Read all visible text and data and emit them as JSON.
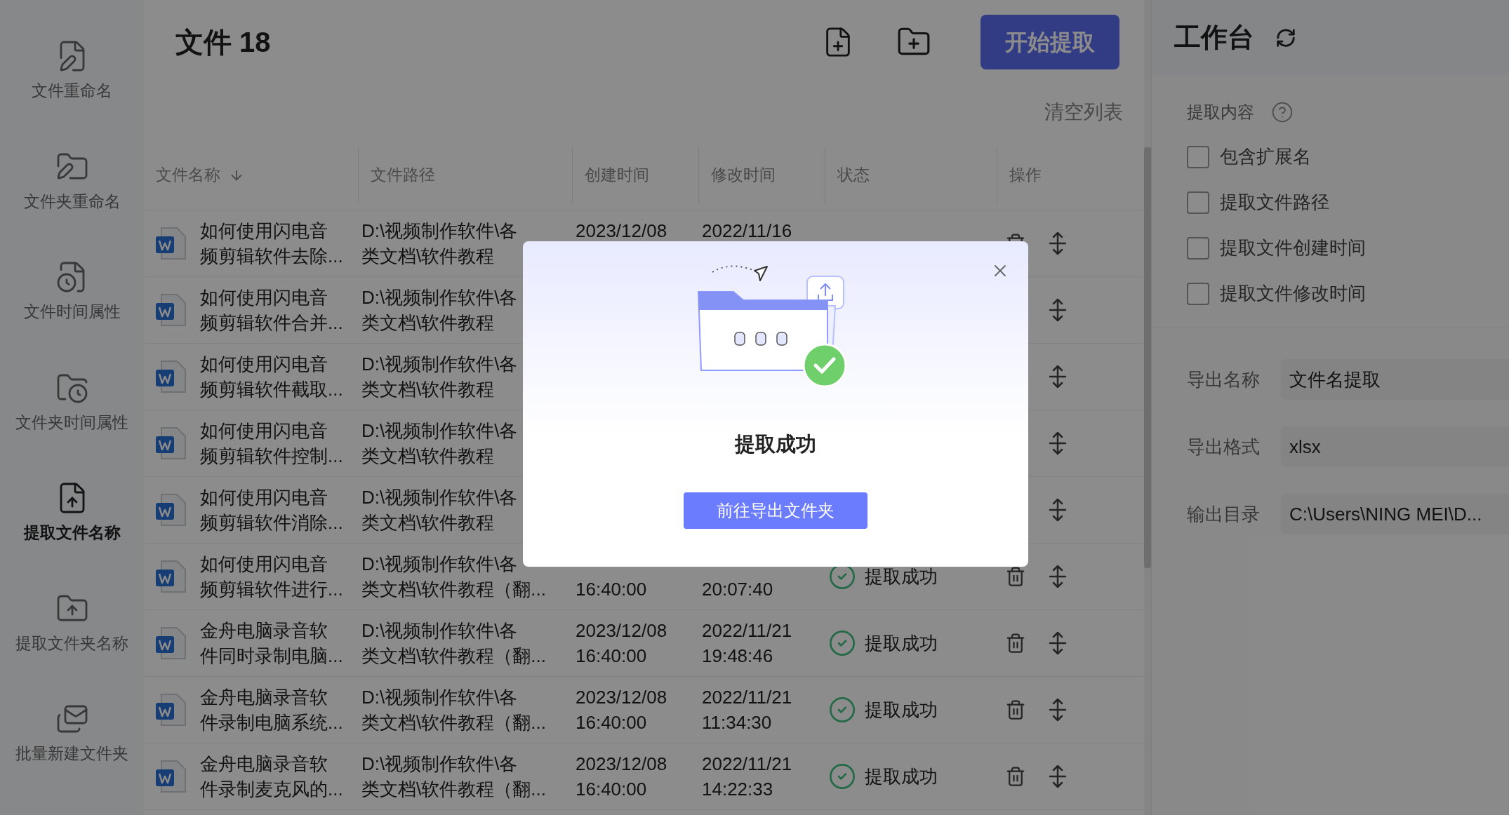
{
  "sidebar": {
    "items": [
      {
        "label": "文件重命名",
        "selected": false
      },
      {
        "label": "文件夹重命名",
        "selected": false
      },
      {
        "label": "文件时间属性",
        "selected": false
      },
      {
        "label": "文件夹时间属性",
        "selected": false
      },
      {
        "label": "提取文件名称",
        "selected": true
      },
      {
        "label": "提取文件夹名称",
        "selected": false
      },
      {
        "label": "批量新建文件夹",
        "selected": false
      }
    ]
  },
  "header": {
    "title": "文件 18",
    "start_button": "开始提取",
    "clear_link": "清空列表"
  },
  "table": {
    "columns": [
      "文件名称",
      "文件路径",
      "创建时间",
      "修改时间",
      "状态",
      "操作"
    ],
    "rows": [
      {
        "name": "如何使用闪电音频剪辑软件去除...",
        "path": "D:\\视频制作软件\\各类文档\\软件教程",
        "created_date": "2023/12/08",
        "modified_date": "2022/11/16"
      },
      {
        "name": "如何使用闪电音频剪辑软件合并...",
        "path": "D:\\视频制作软件\\各类文档\\软件教程",
        "delete_shown": false
      },
      {
        "name": "如何使用闪电音频剪辑软件截取...",
        "path": "D:\\视频制作软件\\各类文档\\软件教程",
        "delete_shown": false
      },
      {
        "name": "如何使用闪电音频剪辑软件控制...",
        "path": "D:\\视频制作软件\\各类文档\\软件教程",
        "delete_shown": false
      },
      {
        "name": "如何使用闪电音频剪辑软件消除...",
        "path": "D:\\视频制作软件\\各类文档\\软件教程",
        "delete_shown": false
      },
      {
        "name": "如何使用闪电音频剪辑软件进行...",
        "path": "D:\\视频制作软件\\各类文档\\软件教程（翻...",
        "created_time": "16:40:00",
        "modified_time": "20:07:40",
        "status": "提取成功"
      },
      {
        "name": "金舟电脑录音软件同时录制电脑...",
        "path": "D:\\视频制作软件\\各类文档\\软件教程（翻...",
        "created_date": "2023/12/08",
        "created_time": "16:40:00",
        "modified_date": "2022/11/21",
        "modified_time": "19:48:46",
        "status": "提取成功"
      },
      {
        "name": "金舟电脑录音软件录制电脑系统...",
        "path": "D:\\视频制作软件\\各类文档\\软件教程（翻...",
        "created_date": "2023/12/08",
        "created_time": "16:40:00",
        "modified_date": "2022/11/21",
        "modified_time": "11:34:30",
        "status": "提取成功"
      },
      {
        "name": "金舟电脑录音软件录制麦克风的...",
        "path": "D:\\视频制作软件\\各类文档\\软件教程（翻...",
        "created_date": "2023/12/08",
        "created_time": "16:40:00",
        "modified_date": "2022/11/21",
        "modified_time": "14:22:33",
        "status": "提取成功"
      }
    ]
  },
  "workbench": {
    "title": "工作台",
    "content_label": "提取内容",
    "options": [
      {
        "label": "包含扩展名",
        "checked": false
      },
      {
        "label": "提取文件路径",
        "checked": false
      },
      {
        "label": "提取文件创建时间",
        "checked": false
      },
      {
        "label": "提取文件修改时间",
        "checked": false
      }
    ],
    "fields": [
      {
        "label": "导出名称",
        "value": "文件名提取"
      },
      {
        "label": "导出格式",
        "value": "xlsx"
      },
      {
        "label": "输出目录",
        "value": "C:\\Users\\NING MEI\\D..."
      }
    ]
  },
  "dialog": {
    "title": "提取成功",
    "button": "前往导出文件夹"
  }
}
